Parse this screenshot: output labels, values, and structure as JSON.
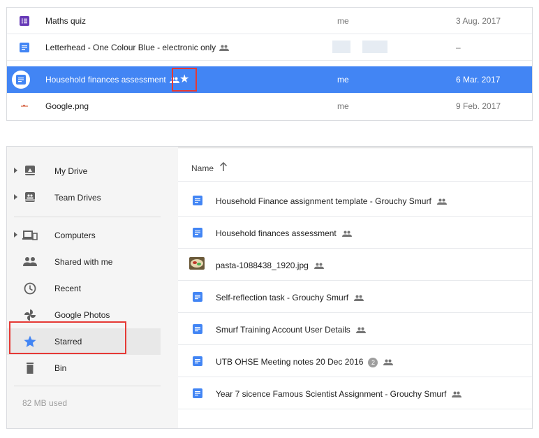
{
  "recent_list": {
    "rows": [
      {
        "name": "Maths quiz",
        "owner": "me",
        "date": "3 Aug. 2017",
        "icon": "form-icon",
        "shared": false
      },
      {
        "name": "Letterhead - One Colour Blue - electronic only",
        "owner": "",
        "date": "–",
        "icon": "doc-icon",
        "shared": true
      },
      {
        "name": "Household finances assessment",
        "owner": "me",
        "date": "6 Mar. 2017",
        "icon": "doc-icon",
        "shared": true,
        "selected": true,
        "starred": true
      },
      {
        "name": "Google.png",
        "owner": "me",
        "date": "9 Feb. 2017",
        "icon": "image-icon",
        "shared": false
      }
    ],
    "star_glyph": "★"
  },
  "sidebar": {
    "items": [
      {
        "label": "My Drive",
        "icon": "drive-icon"
      },
      {
        "label": "Team Drives",
        "icon": "team-drives-icon"
      },
      {
        "label": "Computers",
        "icon": "computers-icon"
      },
      {
        "label": "Shared with me",
        "icon": "people-icon"
      },
      {
        "label": "Recent",
        "icon": "clock-icon"
      },
      {
        "label": "Google Photos",
        "icon": "photos-pinwheel-icon"
      },
      {
        "label": "Starred",
        "icon": "star-icon",
        "active": true
      },
      {
        "label": "Bin",
        "icon": "trash-icon"
      }
    ],
    "storage": "82 MB used"
  },
  "main": {
    "column_header": "Name",
    "files": [
      {
        "name": "Household Finance assignment template - Grouchy Smurf",
        "icon": "doc-icon",
        "shared": true
      },
      {
        "name": "Household finances assessment",
        "icon": "doc-icon",
        "shared": true
      },
      {
        "name": "pasta-1088438_1920.jpg",
        "icon": "image-thumbnail",
        "shared": true
      },
      {
        "name": "Self-reflection task - Grouchy Smurf",
        "icon": "doc-icon",
        "shared": true
      },
      {
        "name": "Smurf Training Account User Details",
        "icon": "doc-icon",
        "shared": true
      },
      {
        "name": "UTB OHSE Meeting notes 20 Dec 2016",
        "icon": "doc-icon",
        "shared": true,
        "badge": "2"
      },
      {
        "name": "Year 7 sicence Famous Scientist Assignment - Grouchy Smurf",
        "icon": "doc-icon",
        "shared": true
      }
    ]
  },
  "colors": {
    "selection": "#4285f4",
    "doc_blue": "#4285f4",
    "form_purple": "#673ab7",
    "highlight_red": "#e53935",
    "star_active": "#4285f4"
  }
}
